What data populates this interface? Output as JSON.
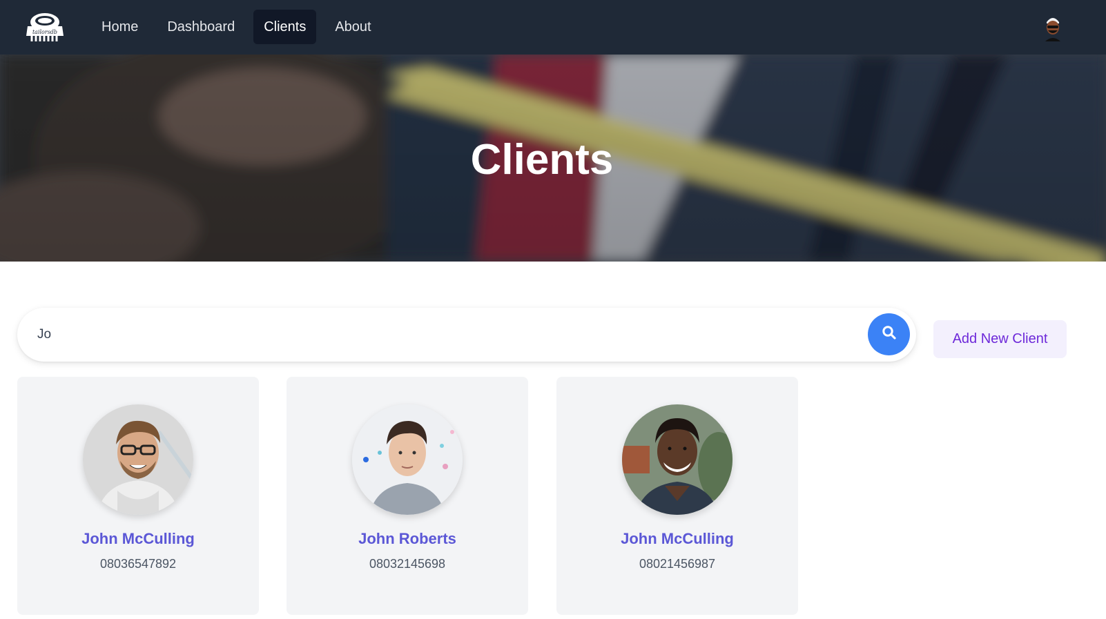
{
  "nav": {
    "logo_icon": "tailorsdb-logo",
    "links": [
      {
        "label": "Home"
      },
      {
        "label": "Dashboard"
      },
      {
        "label": "Clients"
      },
      {
        "label": "About"
      }
    ],
    "active_link": "Clients",
    "avatar_icon": "user-avatar"
  },
  "hero": {
    "title": "Clients"
  },
  "search": {
    "value": "Jo",
    "icon": "search-icon"
  },
  "actions": {
    "add_client_label": "Add New Client"
  },
  "clients": [
    {
      "name": "John McCulling",
      "phone": "08036547892"
    },
    {
      "name": "John Roberts",
      "phone": "08032145698"
    },
    {
      "name": "John McCulling",
      "phone": "08021456987"
    }
  ],
  "colors": {
    "navbar": "#1f2937",
    "nav_active": "#111827",
    "search_button": "#3b82f6",
    "client_name": "#5b57d6",
    "add_button_text": "#6d28d9",
    "add_button_bg": "#f3f0fd",
    "card_bg": "#f3f4f6"
  }
}
